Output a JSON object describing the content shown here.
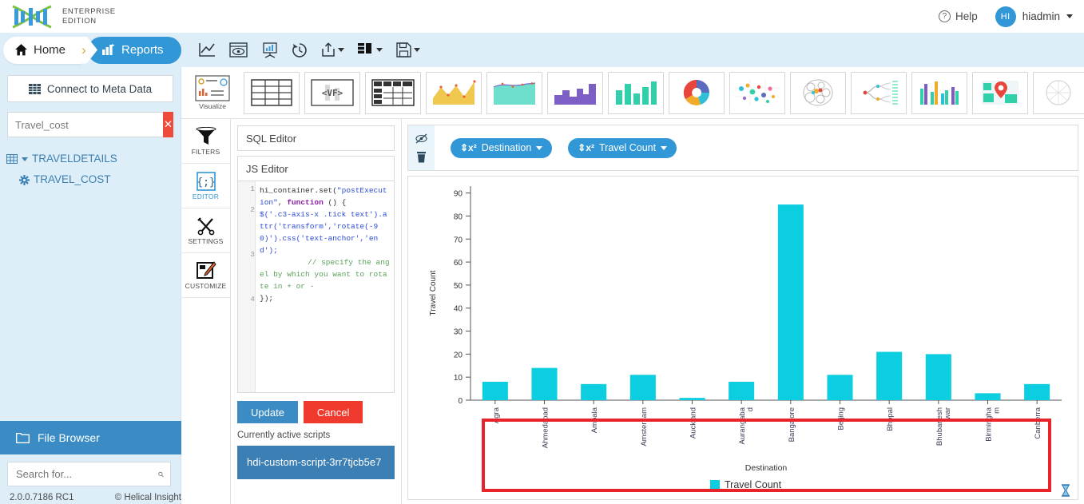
{
  "brand": {
    "line1": "ENTERPRISE",
    "line2": "EDITION",
    "logo_icon": "dna-logo-icon"
  },
  "topbar": {
    "help_label": "Help",
    "help_icon": "question-circle-icon",
    "user_name": "hiadmin",
    "user_initials": "HI",
    "avatar_color": "#3197d6"
  },
  "nav": {
    "home_label": "Home",
    "home_icon": "home-icon",
    "separator_icon": "chevron-right-icon",
    "reports_label": "Reports",
    "reports_icon": "bar-chart-icon",
    "tools": [
      {
        "name": "line-chart-icon"
      },
      {
        "name": "preview-eye-icon"
      },
      {
        "name": "presentation-chart-icon"
      },
      {
        "name": "history-clock-icon"
      },
      {
        "name": "export-share-icon",
        "has_caret": true
      },
      {
        "name": "layout-columns-icon",
        "has_caret": true
      },
      {
        "name": "save-disk-icon",
        "has_caret": true
      }
    ]
  },
  "sidebar": {
    "connect_label": "Connect to Meta Data",
    "connect_icon": "grid-table-icon",
    "search_value": "Travel_cost",
    "search_placeholder": "Travel_cost",
    "clear_icon": "close-x-icon",
    "clear_color": "#ee4b3c",
    "tree": [
      {
        "label": "TRAVELDETAILS",
        "icon": "table-icon",
        "has_caret": true,
        "child": false
      },
      {
        "label": "TRAVEL_COST",
        "icon": "gear-icon",
        "has_caret": false,
        "child": true
      }
    ],
    "file_browser_label": "File Browser",
    "file_browser_icon": "folder-icon",
    "fb_search_placeholder": "Search for...",
    "fb_search_icon": "search-icon",
    "version": "2.0.0.7186 RC1",
    "copyright": "© Helical Insight"
  },
  "chart_types": [
    {
      "name": "visualize-icon",
      "label": "Visualize"
    },
    {
      "name": "table-grid-icon",
      "label": ""
    },
    {
      "name": "vf-template-icon",
      "label": ""
    },
    {
      "name": "pivot-table-icon",
      "label": ""
    },
    {
      "name": "area-spline-chart-icon",
      "label": ""
    },
    {
      "name": "area-chart-icon",
      "label": ""
    },
    {
      "name": "step-bar-chart-icon",
      "label": ""
    },
    {
      "name": "column-chart-icon",
      "label": ""
    },
    {
      "name": "donut-chart-icon",
      "label": ""
    },
    {
      "name": "bubble-scatter-chart-icon",
      "label": ""
    },
    {
      "name": "circle-packing-icon",
      "label": ""
    },
    {
      "name": "dendrogram-icon",
      "label": ""
    },
    {
      "name": "grouped-bar-chart-icon",
      "label": ""
    },
    {
      "name": "map-chart-icon",
      "label": ""
    },
    {
      "name": "radial-chart-icon",
      "label": ""
    }
  ],
  "rail": [
    {
      "label": "FILTERS",
      "icon": "funnel-filter-icon",
      "active": false
    },
    {
      "label": "EDITOR",
      "icon": "curly-braces-icon",
      "active": true
    },
    {
      "label": "SETTINGS",
      "icon": "tools-wrench-icon",
      "active": false
    },
    {
      "label": "CUSTOMIZE",
      "icon": "customize-pencil-icon",
      "active": false
    }
  ],
  "editor": {
    "sql_tab": "SQL Editor",
    "js_tab": "JS Editor",
    "line_numbers": [
      "1",
      "2",
      "3",
      "4"
    ],
    "code_line1_a": "hi_container.set(",
    "code_line1_str": "\"postExecution\"",
    "code_line1_b": ", ",
    "code_line1_kw": "function",
    "code_line1_c": " () {",
    "code_line2": "$('.c3-axis-x .tick text').attr('transform','rotate(-90)').css('text-anchor','end');",
    "code_line3_comment": "// specify the angel by which you want to rotate in + or -",
    "code_line4": "});",
    "update_label": "Update",
    "cancel_label": "Cancel",
    "update_color": "#3b8cc4",
    "cancel_color": "#f03a2e",
    "active_scripts_label": "Currently active scripts",
    "active_script_name": "hdi-custom-script-3rr7tjcb5e7"
  },
  "pills": {
    "hide_icon": "eye-slash-icon",
    "delete_icon": "trash-icon",
    "items": [
      {
        "label": "Destination",
        "sort_icon": "sort-x2-icon"
      },
      {
        "label": "Travel Count",
        "sort_icon": "sort-x2-icon"
      }
    ]
  },
  "highlight": {
    "color": "#e8232a",
    "note": "red-annotation-box-around-x-axis"
  },
  "resize_handle_icon": "hourglass-resize-icon",
  "chart_data": {
    "type": "bar",
    "title": "",
    "xlabel": "Destination",
    "ylabel": "Travel Count",
    "ylim": [
      0,
      93
    ],
    "yticks": [
      0,
      10,
      20,
      30,
      40,
      50,
      60,
      70,
      80,
      90
    ],
    "grid": false,
    "legend_position": "bottom",
    "series_color": "#0ccee0",
    "legend": [
      "Travel Count"
    ],
    "categories": [
      "Agra",
      "Ahmedabad",
      "Ambala",
      "Amsterdam",
      "Auckland",
      "Aurangabad",
      "Bangalore",
      "Beijing",
      "Bhopal",
      "Bhubaneshwar",
      "Birmingham",
      "Canberra"
    ],
    "values": [
      8,
      14,
      7,
      11,
      1,
      8,
      85,
      11,
      21,
      20,
      3,
      7
    ]
  }
}
